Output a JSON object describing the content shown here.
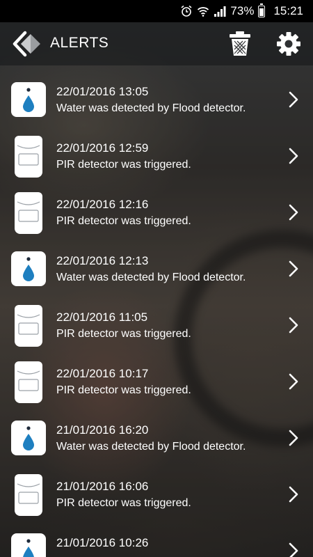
{
  "status_bar": {
    "battery": "73%",
    "time": "15:21"
  },
  "header": {
    "title": "ALERTS"
  },
  "alerts": [
    {
      "type": "flood",
      "icon": "flood-detector-icon",
      "date": "22/01/2016 13:05",
      "message": "Water was detected by Flood detector."
    },
    {
      "type": "pir",
      "icon": "pir-detector-icon",
      "date": "22/01/2016 12:59",
      "message": "PIR detector was triggered."
    },
    {
      "type": "pir",
      "icon": "pir-detector-icon",
      "date": "22/01/2016 12:16",
      "message": "PIR detector was triggered."
    },
    {
      "type": "flood",
      "icon": "flood-detector-icon",
      "date": "22/01/2016 12:13",
      "message": "Water was detected by Flood detector."
    },
    {
      "type": "pir",
      "icon": "pir-detector-icon",
      "date": "22/01/2016 11:05",
      "message": "PIR detector was triggered."
    },
    {
      "type": "pir",
      "icon": "pir-detector-icon",
      "date": "22/01/2016 10:17",
      "message": "PIR detector was triggered."
    },
    {
      "type": "flood",
      "icon": "flood-detector-icon",
      "date": "21/01/2016 16:20",
      "message": "Water was detected by Flood detector."
    },
    {
      "type": "pir",
      "icon": "pir-detector-icon",
      "date": "21/01/2016 16:06",
      "message": "PIR detector was triggered."
    },
    {
      "type": "flood",
      "icon": "flood-detector-icon",
      "date": "21/01/2016 10:26",
      "message": ""
    }
  ],
  "colors": {
    "water_drop": "#1e7fc0",
    "status_bar": "#000000"
  }
}
